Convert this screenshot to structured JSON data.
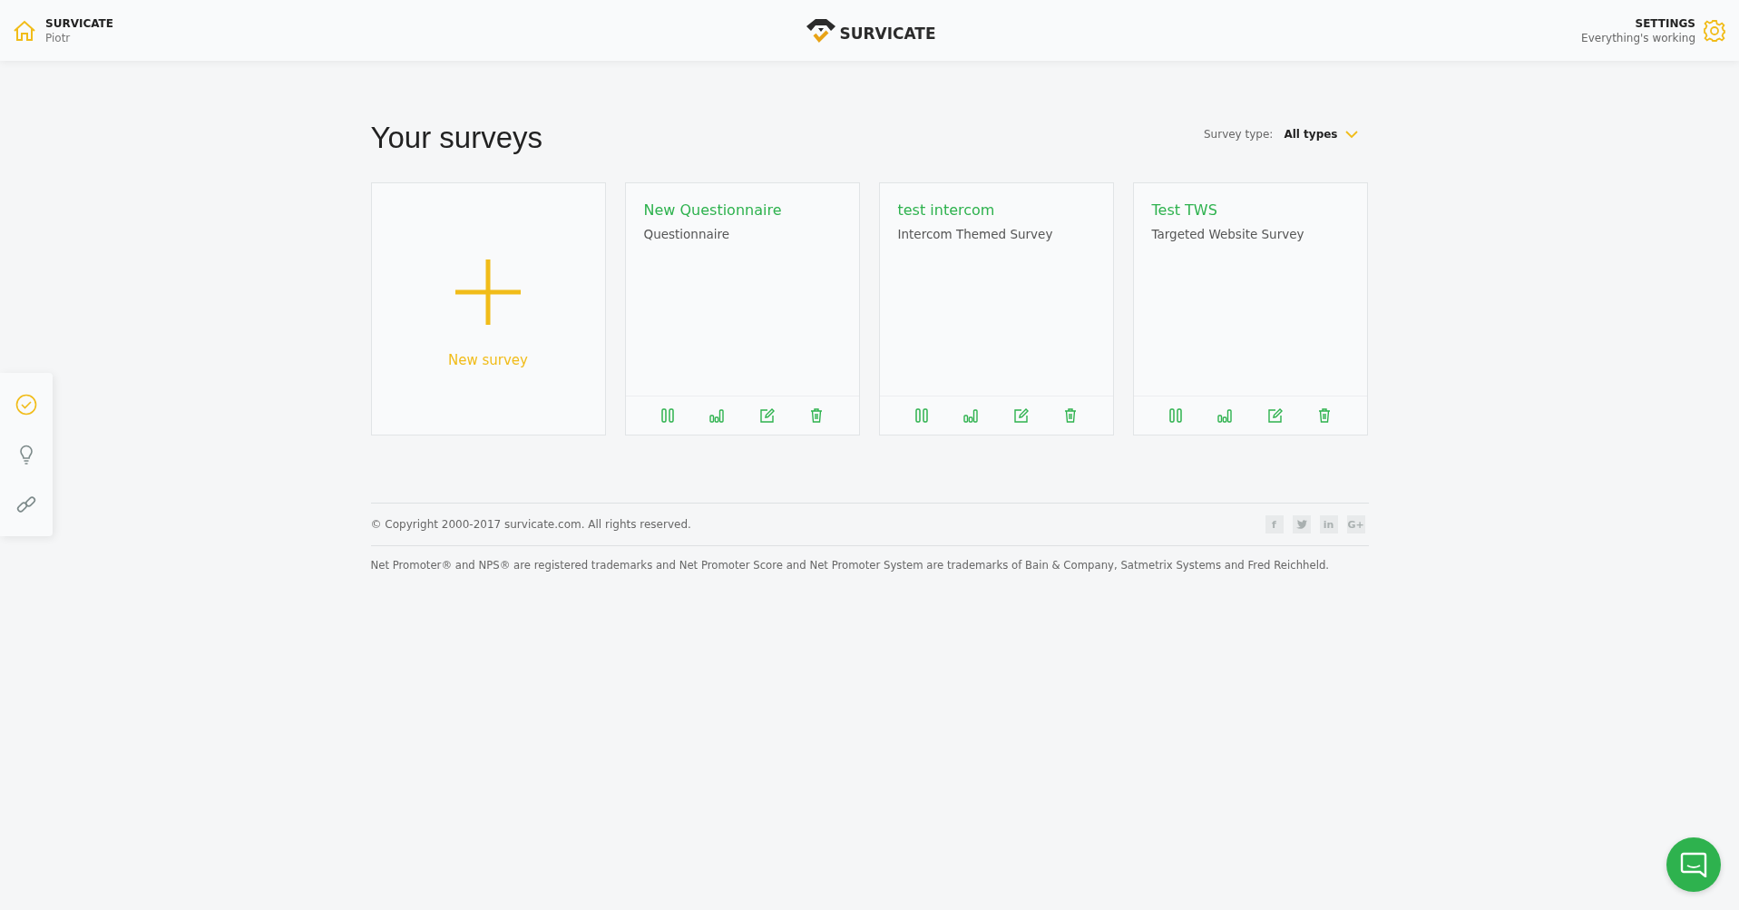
{
  "header": {
    "account": {
      "name": "SURVICATE",
      "user": "Piotr"
    },
    "logo": "SURVICATE",
    "settings": {
      "title": "SETTINGS",
      "status": "Everything's working"
    }
  },
  "side_rail": [
    {
      "kind": "check",
      "selected": true
    },
    {
      "kind": "bulb",
      "selected": false
    },
    {
      "kind": "link",
      "selected": false
    }
  ],
  "page": {
    "title": "Your surveys",
    "filter": {
      "label": "Survey type:",
      "value": "All types"
    }
  },
  "new_survey": {
    "label": "New survey"
  },
  "surveys": [
    {
      "name": "New Questionnaire",
      "type": "Questionnaire"
    },
    {
      "name": "test intercom",
      "type": "Intercom Themed Survey"
    },
    {
      "name": "Test TWS",
      "type": "Targeted Website Survey"
    }
  ],
  "footer": {
    "copyright": "© Copyright 2000-2017 survicate.com. All rights reserved.",
    "social": [
      {
        "kind": "text",
        "label": "f"
      },
      {
        "kind": "bird"
      },
      {
        "kind": "text",
        "label": "in"
      },
      {
        "kind": "text",
        "label": "G+"
      }
    ],
    "trademarks": "Net Promoter® and NPS® are registered trademarks and Net Promoter Score and Net Promoter System are trademarks of Bain & Company, Satmetrix Systems and Fred Reichheld."
  }
}
